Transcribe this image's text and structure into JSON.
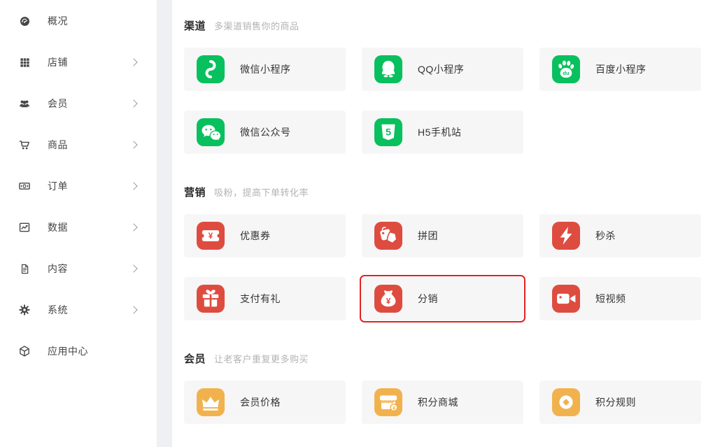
{
  "colors": {
    "green": "#08c05e",
    "red": "#de4c40",
    "gold": "#f1b24e",
    "selected_border": "#e12222"
  },
  "sidebar": {
    "items": [
      {
        "id": "overview",
        "icon": "dashboard-icon",
        "label": "概况",
        "has_submenu": false
      },
      {
        "id": "shop",
        "icon": "grid-icon",
        "label": "店铺",
        "has_submenu": true
      },
      {
        "id": "members",
        "icon": "users-icon",
        "label": "会员",
        "has_submenu": true
      },
      {
        "id": "products",
        "icon": "cart-icon",
        "label": "商品",
        "has_submenu": true
      },
      {
        "id": "orders",
        "icon": "bill-icon",
        "label": "订单",
        "has_submenu": true
      },
      {
        "id": "data",
        "icon": "chart-icon",
        "label": "数据",
        "has_submenu": true
      },
      {
        "id": "content",
        "icon": "document-icon",
        "label": "内容",
        "has_submenu": true
      },
      {
        "id": "system",
        "icon": "gear-icon",
        "label": "系统",
        "has_submenu": true
      },
      {
        "id": "app-center",
        "icon": "cube-icon",
        "label": "应用中心",
        "has_submenu": false
      }
    ]
  },
  "main": {
    "sections": [
      {
        "title": "渠道",
        "subtitle": "多渠道销售你的商品",
        "cards": [
          {
            "id": "wechat-mini-program",
            "icon": "wechat-mini-program-icon",
            "label": "微信小程序",
            "color": "#08c05e",
            "selected": false
          },
          {
            "id": "qq-mini-program",
            "icon": "qq-penguin-icon",
            "label": "QQ小程序",
            "color": "#08c05e",
            "selected": false
          },
          {
            "id": "baidu-mini-program",
            "icon": "baidu-paw-icon",
            "label": "百度小程序",
            "color": "#08c05e",
            "selected": false
          },
          {
            "id": "wechat-official-account",
            "icon": "wechat-chat-bubbles-icon",
            "label": "微信公众号",
            "color": "#08c05e",
            "selected": false
          },
          {
            "id": "h5-mobile-site",
            "icon": "h5-shield-icon",
            "label": "H5手机站",
            "color": "#08c05e",
            "selected": false
          }
        ]
      },
      {
        "title": "营销",
        "subtitle": "吸粉，提高下单转化率",
        "cards": [
          {
            "id": "coupon",
            "icon": "coupon-ticket-icon",
            "label": "优惠券",
            "color": "#de4c40",
            "selected": false
          },
          {
            "id": "group-buy",
            "icon": "group-buy-tag-icon",
            "label": "拼团",
            "color": "#de4c40",
            "selected": false
          },
          {
            "id": "flash-sale",
            "icon": "lightning-icon",
            "label": "秒杀",
            "color": "#de4c40",
            "selected": false
          },
          {
            "id": "payment-gift",
            "icon": "gift-box-icon",
            "label": "支付有礼",
            "color": "#de4c40",
            "selected": false
          },
          {
            "id": "distribution",
            "icon": "money-bag-icon",
            "label": "分销",
            "color": "#de4c40",
            "selected": true
          },
          {
            "id": "short-video",
            "icon": "video-camera-icon",
            "label": "短视频",
            "color": "#de4c40",
            "selected": false
          }
        ]
      },
      {
        "title": "会员",
        "subtitle": "让老客户重复更多购买",
        "cards": [
          {
            "id": "member-price",
            "icon": "crown-icon",
            "label": "会员价格",
            "color": "#f1b24e",
            "selected": false
          },
          {
            "id": "points-mall",
            "icon": "storefront-coin-icon",
            "label": "积分商城",
            "color": "#f1b24e",
            "selected": false
          },
          {
            "id": "points-rules",
            "icon": "coin-diamond-icon",
            "label": "积分规则",
            "color": "#f1b24e",
            "selected": false
          }
        ]
      }
    ]
  }
}
